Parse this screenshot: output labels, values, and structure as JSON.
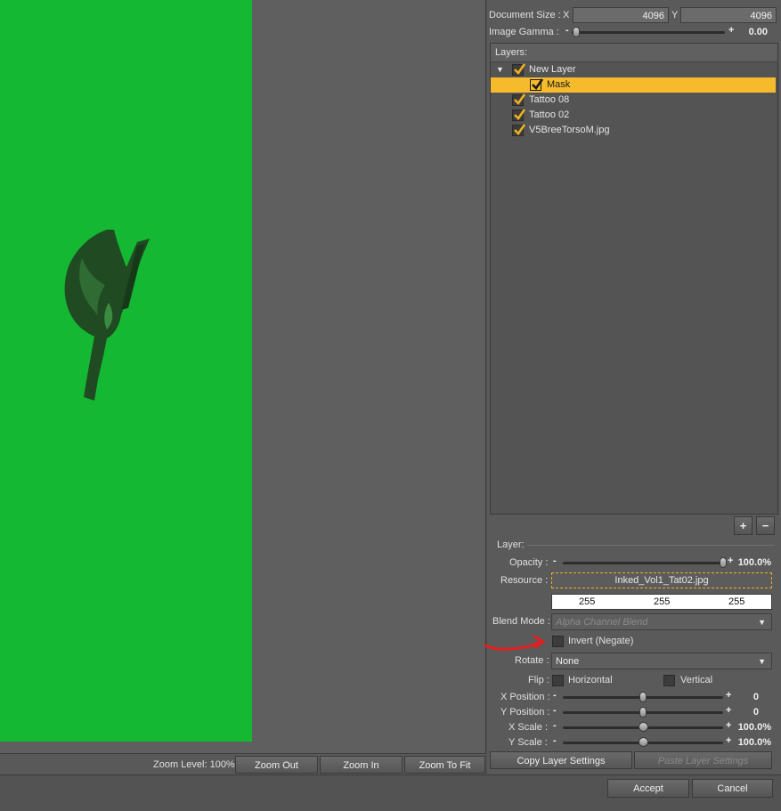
{
  "document": {
    "size_label": "Document Size :",
    "x_label": "X",
    "x_value": "4096",
    "y_label": "Y",
    "y_value": "4096",
    "gamma_label": "Image Gamma :",
    "gamma_value": "0.00"
  },
  "layers": {
    "header": "Layers:",
    "items": [
      {
        "label": "New Layer",
        "checked": true,
        "expanded": true
      },
      {
        "label": "Mask",
        "checked": true,
        "selected": true
      },
      {
        "label": "Tattoo 08",
        "checked": true
      },
      {
        "label": "Tattoo 02",
        "checked": true
      },
      {
        "label": "V5BreeTorsoM.jpg",
        "checked": true
      }
    ],
    "add_label": "+",
    "remove_label": "−"
  },
  "layer": {
    "group_label": "Layer:",
    "opacity_label": "Opacity :",
    "opacity_value": "100.0%",
    "resource_label": "Resource :",
    "resource_value": "Inked_Vol1_Tat02.jpg",
    "color": [
      "255",
      "255",
      "255"
    ],
    "blend_label": "Blend Mode :",
    "blend_value": "Alpha Channel Blend",
    "invert_label": "Invert (Negate)",
    "rotate_label": "Rotate :",
    "rotate_value": "None",
    "flip_label": "Flip :",
    "flip_horizontal": "Horizontal",
    "flip_vertical": "Vertical",
    "xpos_label": "X Position :",
    "xpos_value": "0",
    "ypos_label": "Y Position :",
    "ypos_value": "0",
    "xscale_label": "X Scale :",
    "xscale_value": "100.0%",
    "yscale_label": "Y Scale :",
    "yscale_value": "100.0%",
    "copy_label": "Copy Layer Settings",
    "paste_label": "Paste Layer Settings"
  },
  "zoom": {
    "level_label": "Zoom Level: 100%",
    "zoom_out": "Zoom Out",
    "zoom_in": "Zoom In",
    "zoom_fit": "Zoom To Fit"
  },
  "dialog": {
    "accept": "Accept",
    "cancel": "Cancel"
  },
  "colors": {
    "canvas_green": "#14b832",
    "selection": "#f5bb2d",
    "annotation": "#e02020"
  },
  "icons": [
    "checkbox-checked-icon",
    "expand-triangle-icon",
    "dropdown-arrow-icon",
    "plus-icon",
    "minus-icon",
    "annotation-arrow"
  ]
}
